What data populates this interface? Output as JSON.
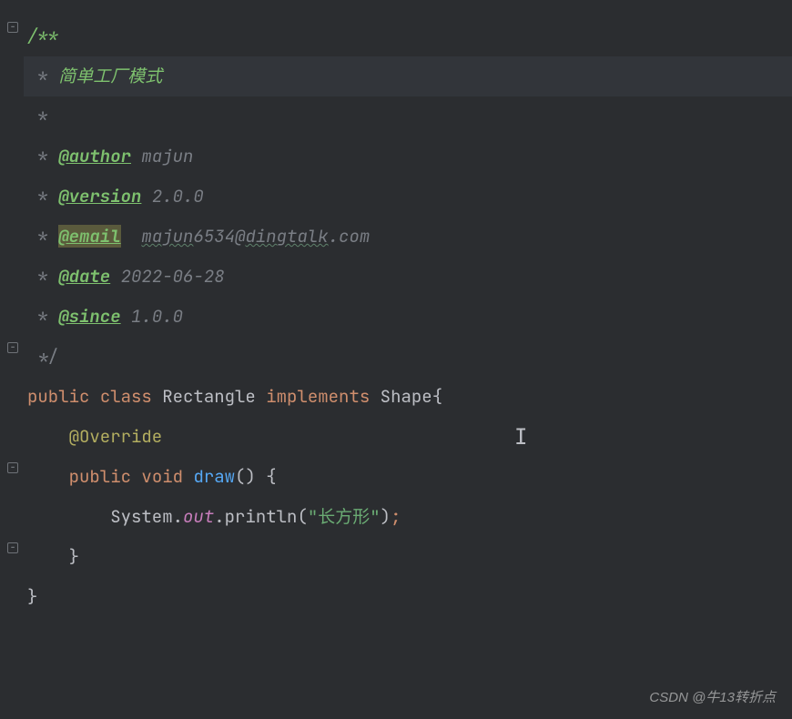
{
  "doc": {
    "open": "/**",
    "desc": "简单工厂模式",
    "star": " * ",
    "star_empty": " *",
    "tags": {
      "author": {
        "tag": "@author",
        "value": "majun"
      },
      "version": {
        "tag": "@version",
        "value": "2.0.0"
      },
      "email": {
        "tag": "@email",
        "value_pre": "majun",
        "value_post": "6534@",
        "value_domain": "dingtalk",
        "value_tld": ".com"
      },
      "date": {
        "tag": "@date",
        "value": "2022-06-28"
      },
      "since": {
        "tag": "@since",
        "value": "1.0.0"
      }
    },
    "close": " */"
  },
  "code": {
    "kw_public": "public",
    "kw_class": "class",
    "class_name": "Rectangle",
    "kw_implements": "implements",
    "iface_name": "Shape",
    "annotation": "@Override",
    "kw_void": "void",
    "method_name": "draw",
    "sys": "System",
    "out": "out",
    "println": "println",
    "str": "\"长方形\""
  },
  "watermark": "CSDN @牛13转折点"
}
